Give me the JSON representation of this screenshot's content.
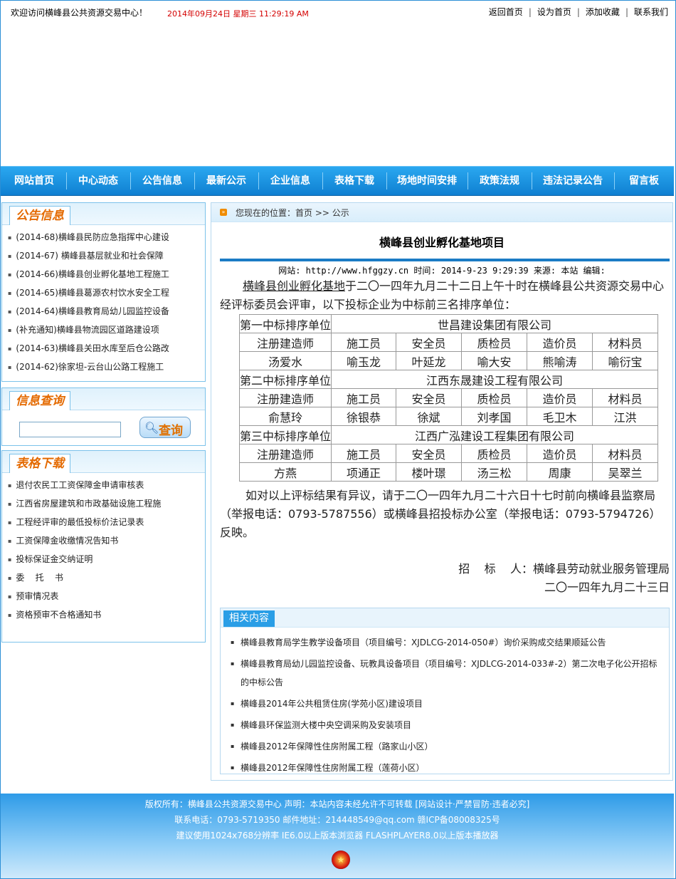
{
  "topbar": {
    "welcome": "欢迎访问横峰县公共资源交易中心！",
    "datetime": "2014年09月24日 星期三  11:29:19 AM",
    "links": [
      "返回首页",
      "设为首页",
      "添加收藏",
      "联系我们"
    ]
  },
  "nav": {
    "items": [
      "网站首页",
      "中心动态",
      "公告信息",
      "最新公示",
      "企业信息",
      "表格下载",
      "场地时间安排",
      "政策法规",
      "违法记录公告",
      "留言板"
    ]
  },
  "sidebar": {
    "notices": {
      "title": "公告信息",
      "items": [
        "(2014-68)横峰县民防应急指挥中心建设",
        "(2014-67) 横峰县基层就业和社会保障",
        "(2014-66)横峰县创业孵化基地工程施工",
        "(2014-65)横峰县葛源农村饮水安全工程",
        "(2014-64)横峰县教育局幼儿园监控设备",
        "(补充通知)横峰县物流园区道路建设项",
        "(2014-63)横峰县关田水库至后仓公路改",
        "(2014-62)徐家坦-云台山公路工程施工"
      ]
    },
    "query": {
      "title": "信息查询",
      "input_value": "",
      "button_label": "查询"
    },
    "downloads": {
      "title": "表格下载",
      "items": [
        "退付农民工工资保障金申请审核表",
        "江西省房屋建筑和市政基础设施工程施",
        "工程经评审的最低投标价法记录表",
        "工资保障金收缴情况告知书",
        "投标保证金交纳证明",
        "委    托    书",
        "预审情况表",
        "资格预审不合格通知书"
      ]
    }
  },
  "breadcrumb": {
    "text": "您现在的位置：首页 >> 公示"
  },
  "article": {
    "title": "横峰县创业孵化基地项目",
    "meta": "网站: http://www.hfggzy.cn  时间: 2014-9-23 9:29:39  来源: 本站  编辑:",
    "intro_link": "横峰县创业孵化基地",
    "intro_rest": "于二〇一四年九月二十二日上午十时在横峰县公共资源交易中心经评标委员会评审，以下投标企业为中标前三名排序单位：",
    "table": {
      "role_headers": [
        "注册建造师",
        "施工员",
        "安全员",
        "质检员",
        "造价员",
        "材料员"
      ],
      "groups": [
        {
          "rank_label": "第一中标排序单位",
          "company": "世昌建设集团有限公司",
          "people": [
            "汤爱水",
            "喻玉龙",
            "叶延龙",
            "喻大安",
            "熊喻涛",
            "喻衍宝"
          ]
        },
        {
          "rank_label": "第二中标排序单位",
          "company": "江西东晟建设工程有限公司",
          "people": [
            "俞慧玲",
            "徐银恭",
            "徐斌",
            "刘孝国",
            "毛卫木",
            "江洪"
          ]
        },
        {
          "rank_label": "第三中标排序单位",
          "company": "江西广泓建设工程集团有限公司",
          "people": [
            "方燕",
            "项通正",
            "楼叶璟",
            "汤三松",
            "周康",
            "吴翠兰"
          ]
        }
      ]
    },
    "objection": "如对以上评标结果有异议，请于二〇一四年九月二十六日十七时前向横峰县监察局（举报电话：0793-5787556）或横峰县招投标办公室（举报电话：0793-5794726）反映。",
    "signer": "招    标    人：横峰县劳动就业服务管理局",
    "sign_date": "二〇一四年九月二十三日"
  },
  "related": {
    "title": "相关内容",
    "items": [
      "横峰县教育局学生教学设备项目（项目编号：XJDLCG-2014-050#）询价采购成交结果顺延公告",
      "横峰县教育局幼儿园监控设备、玩教具设备项目（项目编号：XJDLCG-2014-033#-2）第二次电子化公开招标的中标公告",
      "横峰县2014年公共租赁住房(学苑小区)建设项目",
      "横峰县环保监测大楼中央空调采购及安装项目",
      "横峰县2012年保障性住房附属工程（路家山小区）",
      "横峰县2012年保障性住房附属工程（莲荷小区）"
    ]
  },
  "footer": {
    "line1": "版权所有：横峰县公共资源交易中心  声明：本站内容未经允许不可转载   [网站设计·严禁冒防·违者必究]",
    "line2": "联系电话：0793-5719350  邮件地址：214448549@qq.com 赣ICP备08008325号",
    "line3": "建议使用1024x768分辨率 IE6.0以上版本浏览器 FLASHPLAYER8.0以上版本播放器"
  },
  "colors": {
    "nav_blue": "#1a8fe0",
    "accent_orange": "#e46a00",
    "date_red": "#d40000",
    "rule_blue": "#1b7cc5"
  }
}
